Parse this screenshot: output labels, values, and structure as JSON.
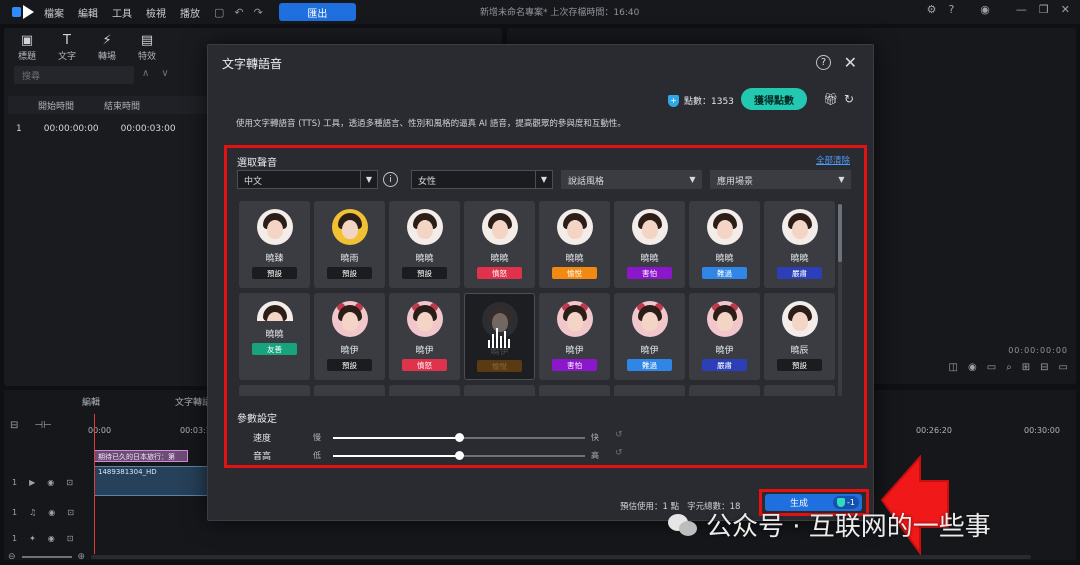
{
  "menubar": {
    "items": [
      "檔案",
      "編輯",
      "工具",
      "檢視",
      "播放"
    ],
    "export_label": "匯出",
    "project_title": "新增未命名專案* 上次存檔時間：16:40"
  },
  "editor": {
    "tool_tabs": [
      "標題",
      "文字",
      "轉場",
      "特效"
    ],
    "search_placeholder": "搜尋",
    "subtitle_header": [
      "開始時間",
      "結束時間"
    ],
    "subtitle_row": {
      "index": "1",
      "start": "00:00:00:00",
      "end": "00:00:03:00"
    },
    "preview_time": "00:00:00:00",
    "timeline_tabs": [
      "編輯",
      "文字轉語音"
    ],
    "ruler": [
      "00:00",
      "00:03:1",
      "00:26:20",
      "00:30:00"
    ],
    "tracks": [
      "1",
      "1",
      "1"
    ],
    "title_clip": "期待已久的日本旅行：第",
    "video_clip": "1489381304_HD"
  },
  "dialog": {
    "title": "文字轉語音",
    "points_label": "點數：1353",
    "get_points_label": "獲得點數",
    "description": "使用文字轉語音 (TTS) 工具，透過多種語言、性別和風格的逼真 AI 語音，提高觀眾的參與度和互動性。",
    "voice_section_title": "選取聲音",
    "clear_all_label": "全部清除",
    "filters": {
      "language": "中文",
      "gender": "女性",
      "style": "說話風格",
      "scene": "應用場景"
    },
    "voices": [
      {
        "name": "曉臻",
        "tag": "預設",
        "tag_color": "#1b1c20",
        "avatar": "real"
      },
      {
        "name": "曉雨",
        "tag": "預設",
        "tag_color": "#1b1c20",
        "avatar": "yellow"
      },
      {
        "name": "曉曉",
        "tag": "預設",
        "tag_color": "#1b1c20",
        "avatar": "girl"
      },
      {
        "name": "曉曉",
        "tag": "憤怒",
        "tag_color": "#e0324b",
        "avatar": "girl"
      },
      {
        "name": "曉曉",
        "tag": "愉悅",
        "tag_color": "#f28a12",
        "avatar": "girl"
      },
      {
        "name": "曉曉",
        "tag": "害怕",
        "tag_color": "#8c16c9",
        "avatar": "girl"
      },
      {
        "name": "曉曉",
        "tag": "難過",
        "tag_color": "#2f86e6",
        "avatar": "girl"
      },
      {
        "name": "曉曉",
        "tag": "嚴肅",
        "tag_color": "#2c3fb8",
        "avatar": "girl"
      },
      {
        "name": "曉曉",
        "tag": "友善",
        "tag_color": "#16a37e",
        "avatar": "girl-cut"
      },
      {
        "name": "曉伊",
        "tag": "預設",
        "tag_color": "#1b1c20",
        "avatar": "pink"
      },
      {
        "name": "曉伊",
        "tag": "憤怒",
        "tag_color": "#e0324b",
        "avatar": "pink"
      },
      {
        "name": "曉伊",
        "tag": "愉悅",
        "tag_color": "#5a3a12",
        "avatar": "dim"
      },
      {
        "name": "曉伊",
        "tag": "害怕",
        "tag_color": "#8c16c9",
        "avatar": "pink"
      },
      {
        "name": "曉伊",
        "tag": "難過",
        "tag_color": "#2f86e6",
        "avatar": "pink"
      },
      {
        "name": "曉伊",
        "tag": "嚴肅",
        "tag_color": "#2c3fb8",
        "avatar": "pink"
      },
      {
        "name": "曉辰",
        "tag": "預設",
        "tag_color": "#1b1c20",
        "avatar": "girl"
      }
    ],
    "params_title": "參數設定",
    "params": [
      {
        "label": "速度",
        "low": "慢",
        "high": "快",
        "value": 0.5
      },
      {
        "label": "音高",
        "low": "低",
        "high": "高",
        "value": 0.5
      }
    ],
    "footer": {
      "estimate": "預估使用：1 點",
      "chars": "字元總數：18"
    },
    "generate_label": "生成",
    "generate_cost": "-1"
  },
  "watermark": "公众号 · 互联网的一些事",
  "colors": {
    "accent": "#1f6fde",
    "highlight": "#e01212",
    "teal": "#22c9b0"
  }
}
